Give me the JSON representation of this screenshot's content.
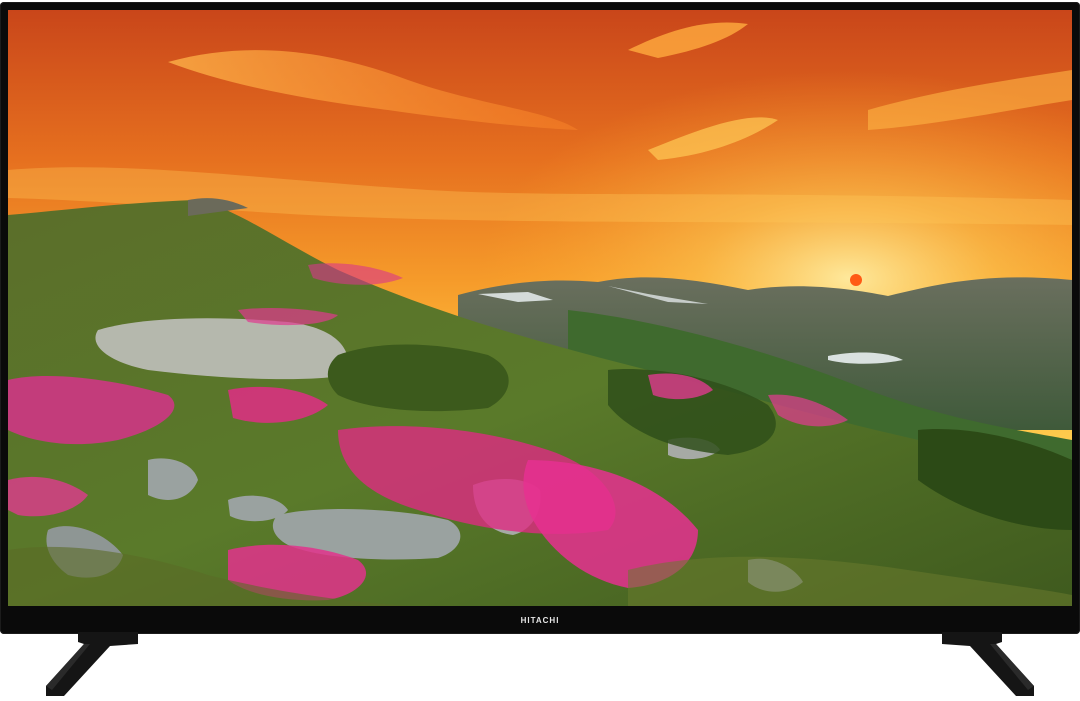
{
  "tv": {
    "brand": "HITACHI"
  },
  "screen": {
    "scene": "mountain-sunset",
    "colors": {
      "sky_top": "#d8581c",
      "sky_mid": "#f08a28",
      "sky_horizon": "#ffc23a",
      "sun": "#ff6a1a",
      "hill_green": "#4f6d24",
      "distant_mountains": "#4c5f52",
      "flowers": "#e0287a",
      "rocks": "#9aa2a0"
    }
  }
}
